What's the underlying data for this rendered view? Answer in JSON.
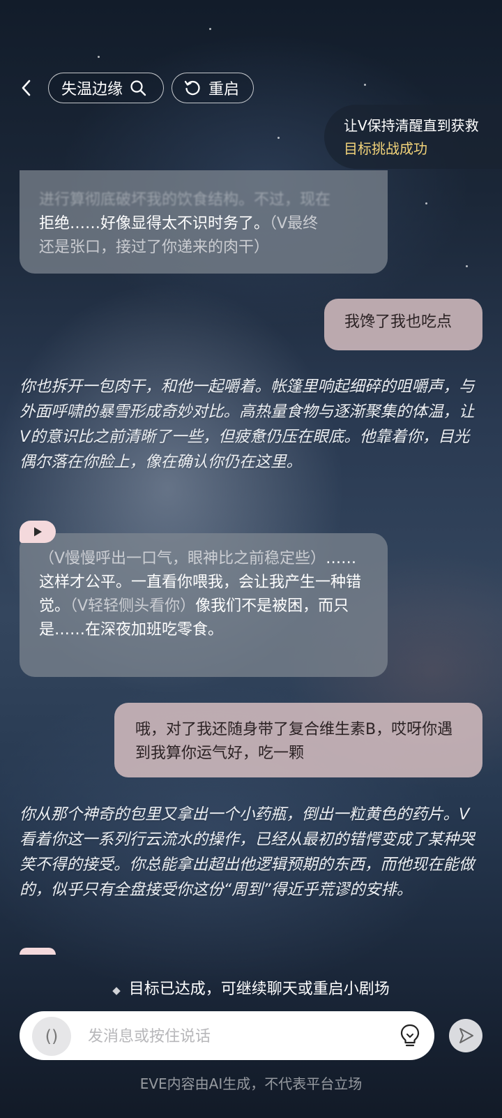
{
  "header": {
    "title": "失温边缘",
    "restart_label": "重启"
  },
  "goal": {
    "text": "让V保持清醒直到获救",
    "status": "目标挑战成功",
    "status_color": "#f2d37a"
  },
  "messages": {
    "ai_1": {
      "line_cut": "进行算彻底破坏我的饮食结构。不过，现在",
      "line_a_normal": "拒绝……好像显得太不识时务了。",
      "line_a_dim": "（V最终",
      "line_b_dim": "还是张口，接过了你递来的肉干）"
    },
    "user_1": "我馋了我也吃点",
    "narration_1": "你也拆开一包肉干，和他一起嚼着。帐篷里响起细碎的咀嚼声，与外面呼啸的暴雪形成奇妙对比。高热量食物与逐渐聚集的体温，让V的意识比之前清晰了一些，但疲惫仍压在眼底。他靠着你，目光偶尔落在你脸上，像在确认你仍在这里。",
    "ai_2": {
      "p1": "（V慢慢呼出一口气，眼神比之前稳定些）",
      "p2": "……这样才公平。一直看你喂我，会让我产生一种错觉。",
      "p3": "（V轻轻侧头看你）",
      "p4": "像我们不是被困，而只是……在深夜加班吃零食。"
    },
    "user_2": "哦，对了我还随身带了复合维生素B，哎呀你遇到我算你运气好，吃一颗",
    "narration_2": "你从那个神奇的包里又拿出一个小药瓶，倒出一粒黄色的药片。V看着你这一系列行云流水的操作，已经从最初的错愕变成了某种哭笑不得的接受。你总能拿出超出他逻辑预期的东西，而他现在能做的，似乎只有全盘接受你这份“周到”得近乎荒谬的安排。"
  },
  "status_line": "目标已达成，可继续聊天或重启小剧场",
  "input": {
    "placeholder": "发消息或按住说话",
    "voice_glyph": "()"
  },
  "disclaimer": "EVE内容由AI生成，不代表平台立场",
  "icons": {
    "back": "chevron-left-icon",
    "search": "search-icon",
    "restart": "refresh-icon",
    "play": "play-icon",
    "bulb": "lightbulb-icon",
    "send": "send-icon"
  }
}
